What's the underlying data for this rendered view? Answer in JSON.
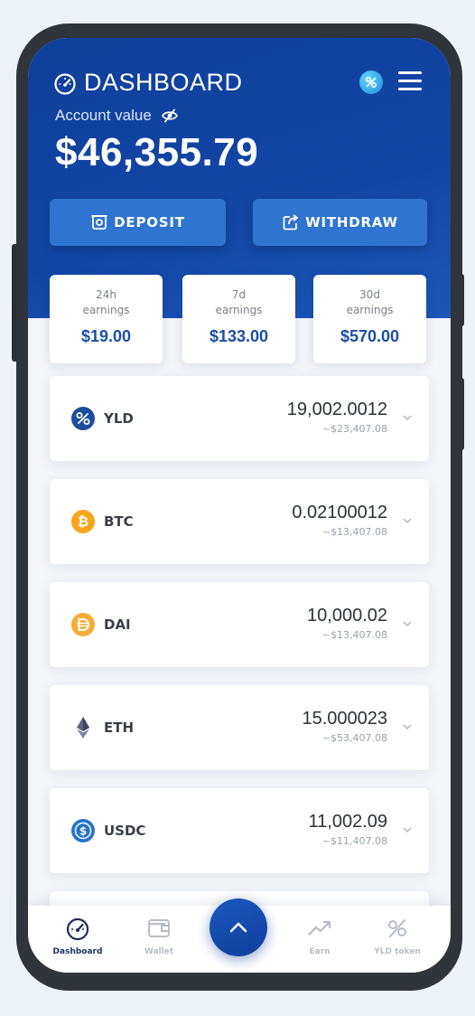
{
  "header": {
    "title": "DASHBOARD",
    "account_label": "Account value",
    "account_value": "$46,355.79",
    "deposit_label": "DEPOSIT",
    "withdraw_label": "WITHDRAW"
  },
  "earnings": [
    {
      "period": "24h earnings",
      "value": "$19.00"
    },
    {
      "period": "7d earnings",
      "value": "$133.00"
    },
    {
      "period": "30d earnings",
      "value": "$570.00"
    }
  ],
  "assets": [
    {
      "symbol": "YLD",
      "amount": "19,002.0012",
      "usd": "~$23,407.08",
      "icon": "yld-icon",
      "color": "#1d4e9e"
    },
    {
      "symbol": "BTC",
      "amount": "0.02100012",
      "usd": "~$13,407.08",
      "icon": "bitcoin-icon",
      "color": "#f7a51c"
    },
    {
      "symbol": "DAI",
      "amount": "10,000.02",
      "usd": "~$13,407.08",
      "icon": "dai-icon",
      "color": "#f5ac37"
    },
    {
      "symbol": "ETH",
      "amount": "15.000023",
      "usd": "~$53,407.08",
      "icon": "ethereum-icon",
      "color": "#5d6280"
    },
    {
      "symbol": "USDC",
      "amount": "11,002.09",
      "usd": "~$11,407.08",
      "icon": "usdc-icon",
      "color": "#2775ca"
    }
  ],
  "nav": {
    "items": [
      {
        "label": "Dashboard",
        "icon": "gauge-icon",
        "active": true
      },
      {
        "label": "Wallet",
        "icon": "wallet-icon",
        "active": false
      },
      {
        "label": "Earn",
        "icon": "trend-up-icon",
        "active": false
      },
      {
        "label": "YLD token",
        "icon": "percent-icon",
        "active": false
      }
    ],
    "fab_icon": "chevron-up-icon"
  },
  "colors": {
    "brand": "#1246a6",
    "button": "#2f74d0",
    "earning_value": "#1a4ea8"
  }
}
